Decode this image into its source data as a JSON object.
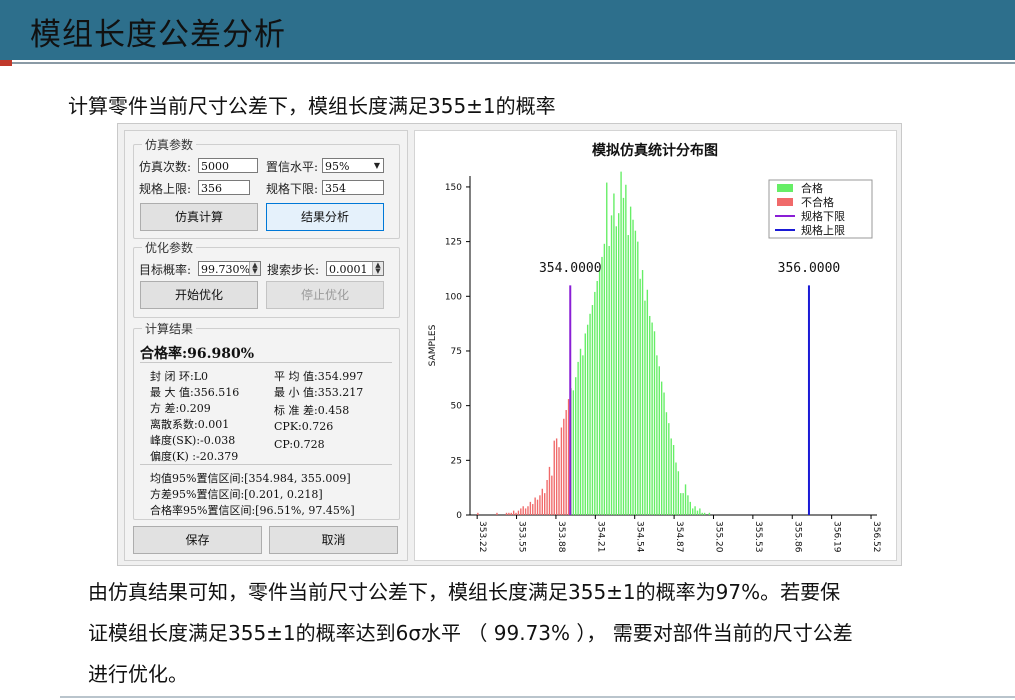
{
  "slide": {
    "title": "模组长度公差分析",
    "subtitle": "计算零件当前尺寸公差下，模组长度满足355±1的概率",
    "conclusion_lines": [
      "由仿真结果可知，零件当前尺寸公差下，模组长度满足355±1的概率为97%。若要保",
      "证模组长度满足355±1的概率达到6σ水平 （ 99.73% ）， 需要对部件当前的尺寸公差",
      "进行优化。"
    ]
  },
  "sim_params": {
    "group_title": "仿真参数",
    "count_label": "仿真次数:",
    "count_value": "5000",
    "confidence_label": "置信水平:",
    "confidence_value": "95%",
    "upper_label": "规格上限:",
    "upper_value": "356",
    "lower_label": "规格下限:",
    "lower_value": "354",
    "simulate_button": "仿真计算",
    "analyze_button": "结果分析"
  },
  "optimize": {
    "group_title": "优化参数",
    "target_label": "目标概率:",
    "target_value": "99.730%",
    "step_label": "搜索步长:",
    "step_value": "0.0001",
    "start_button": "开始优化",
    "stop_button": "停止优化"
  },
  "results": {
    "group_title": "计算结果",
    "pass_rate": "合格率:96.980%",
    "left_lines": [
      "封 闭 环:L0",
      "最 大 值:356.516",
      "方      差:0.209",
      "离散系数:0.001",
      "峰度(SK):-0.038",
      "偏度(K)  :-20.379"
    ],
    "right_lines": [
      "平 均 值:354.997",
      "最 小 值:353.217",
      "标 准 差:0.458",
      "CPK:0.726",
      "CP:0.728"
    ],
    "interval_lines": [
      "均值95%置信区间:[354.984, 355.009]",
      "方差95%置信区间:[0.201, 0.218]",
      "合格率95%置信区间:[96.51%, 97.45%]"
    ],
    "save_button": "保存",
    "cancel_button": "取消"
  },
  "colors": {
    "pass": "#66ee66",
    "fail": "#f06a6a",
    "lower_limit": "#8a1ed6",
    "upper_limit": "#1a1ad6"
  },
  "chart_data": {
    "type": "bar",
    "title": "模拟仿真统计分布图",
    "xlabel": "",
    "ylabel": "SAMPLES",
    "xlim": [
      353.16,
      356.57
    ],
    "ylim": [
      0,
      155
    ],
    "yticks": [
      "0",
      "25",
      "50",
      "75",
      "100",
      "125",
      "150"
    ],
    "ytick_values": [
      0,
      25,
      50,
      75,
      100,
      125,
      150
    ],
    "xticks": [
      "353.22",
      "353.55",
      "353.88",
      "354.21",
      "354.54",
      "354.87",
      "355.20",
      "355.53",
      "355.86",
      "356.19",
      "356.52"
    ],
    "xtick_values": [
      353.22,
      353.55,
      353.88,
      354.21,
      354.54,
      354.87,
      355.2,
      355.53,
      355.86,
      356.19,
      356.52
    ],
    "limit_lines": [
      {
        "label": "354.0000",
        "value": 354.0,
        "kind": "lower"
      },
      {
        "label": "356.0000",
        "value": 356.0,
        "kind": "upper"
      }
    ],
    "legend": [
      "合格",
      "不合格",
      "规格下限",
      "规格上限"
    ],
    "legend_position": "top-right",
    "grid": false,
    "bin_width": 0.02,
    "bin_start": 353.22,
    "counts": [
      1,
      0,
      0,
      0,
      0,
      0,
      0,
      0,
      1,
      0,
      0,
      0,
      1,
      1,
      1,
      2,
      1,
      2,
      3,
      4,
      3,
      4,
      6,
      5,
      8,
      7,
      9,
      12,
      10,
      16,
      22,
      18,
      34,
      35,
      31,
      40,
      44,
      48,
      53,
      58,
      57,
      63,
      70,
      76,
      73,
      83,
      87,
      92,
      96,
      102,
      107,
      112,
      118,
      124,
      152,
      123,
      137,
      147,
      132,
      138,
      157,
      145,
      151,
      128,
      141,
      135,
      130,
      125,
      108,
      112,
      98,
      103,
      91,
      88,
      84,
      73,
      68,
      61,
      56,
      47,
      42,
      35,
      32,
      24,
      20,
      10,
      10,
      14,
      9,
      6,
      3,
      4,
      2,
      3,
      1,
      1,
      0,
      1
    ]
  }
}
